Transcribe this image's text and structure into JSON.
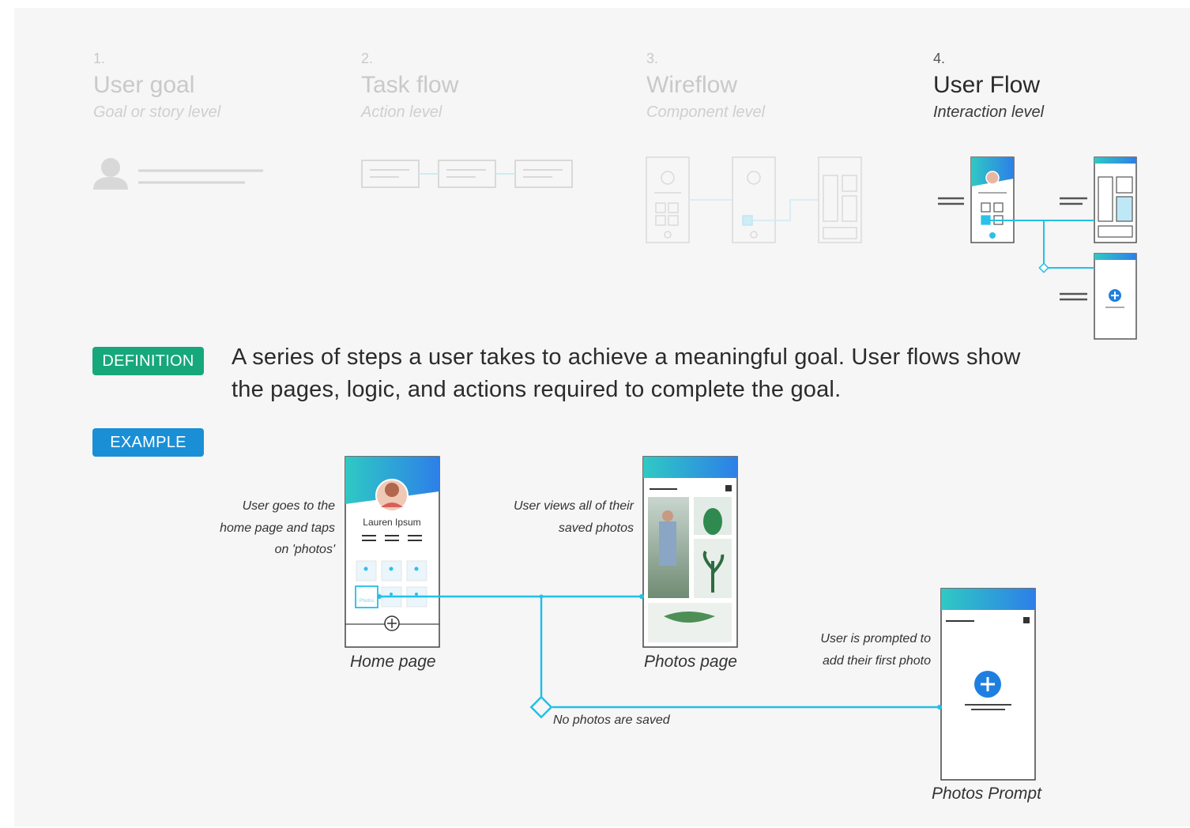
{
  "stages": [
    {
      "number": "1.",
      "title": "User goal",
      "subtitle": "Goal or story level"
    },
    {
      "number": "2.",
      "title": "Task flow",
      "subtitle": "Action level"
    },
    {
      "number": "3.",
      "title": "Wireflow",
      "subtitle": "Component level"
    },
    {
      "number": "4.",
      "title": "User Flow",
      "subtitle": "Interaction level"
    }
  ],
  "definition": {
    "badge": "DEFINITION",
    "text": "A series of steps a user takes to achieve a meaningful goal. User flows show the pages, logic, and actions required to complete the goal."
  },
  "example": {
    "badge": "EXAMPLE",
    "notes": {
      "home": "User goes to the home page and taps on 'photos'",
      "photos": "User views all of their saved photos",
      "prompt": "User is prompted to add their first photo",
      "condition": "No photos are saved"
    },
    "screens": {
      "home": "Home page",
      "photos": "Photos page",
      "prompt": "Photos Prompt"
    },
    "profile_name": "Lauren Ipsum",
    "photos_tile_label": "Photos"
  },
  "colors": {
    "definition_badge": "#16a87a",
    "example_badge": "#1a8fd6",
    "flow_line": "#22c0e8",
    "plus_button": "#1f7fe0",
    "header_gradient_start": "#2fc9c4",
    "header_gradient_end": "#2d7fe8"
  },
  "icons": [
    "user-silhouette-icon",
    "avatar-icon",
    "plus-icon",
    "decision-diamond-icon"
  ]
}
